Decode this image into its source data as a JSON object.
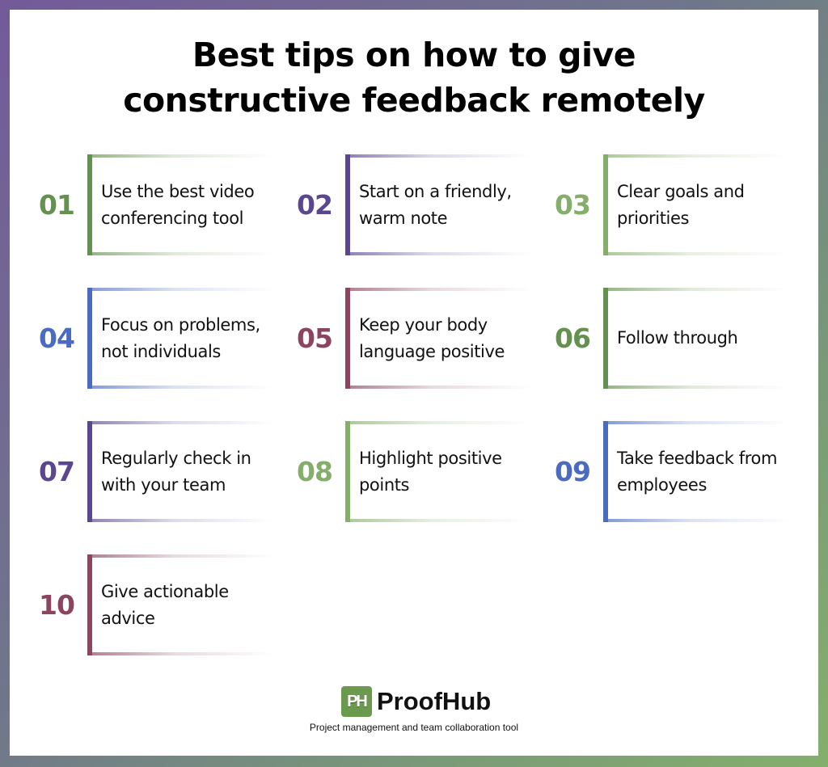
{
  "title": {
    "line1": "Best tips on how to give",
    "line2": "constructive feedback remotely"
  },
  "colors": {
    "green_dark": "#64914f",
    "purple": "#5a4790",
    "green_light": "#86ae6b",
    "blue": "#4a6bbf",
    "maroon": "#8b4560",
    "border_start": "#735a9b",
    "border_end": "#85af6c"
  },
  "tips": [
    {
      "number": "01",
      "text": "Use the best video conferencing tool",
      "color": "#64914f"
    },
    {
      "number": "02",
      "text": "Start on a friendly, warm note",
      "color": "#5a4790"
    },
    {
      "number": "03",
      "text": "Clear goals and priorities",
      "color": "#86ae6b"
    },
    {
      "number": "04",
      "text": "Focus on problems, not individuals",
      "color": "#4a6bbf"
    },
    {
      "number": "05",
      "text": "Keep your body language positive",
      "color": "#8b4560"
    },
    {
      "number": "06",
      "text": "Follow through",
      "color": "#64914f"
    },
    {
      "number": "07",
      "text": "Regularly check in with your team",
      "color": "#5a4790"
    },
    {
      "number": "08",
      "text": "Highlight positive points",
      "color": "#86ae6b"
    },
    {
      "number": "09",
      "text": "Take feedback from employees",
      "color": "#4a6bbf"
    },
    {
      "number": "10",
      "text": "Give actionable advice",
      "color": "#8b4560"
    }
  ],
  "brand": {
    "logo_icon": "PH",
    "name": "ProofHub",
    "tagline": "Project management and team collaboration tool"
  }
}
